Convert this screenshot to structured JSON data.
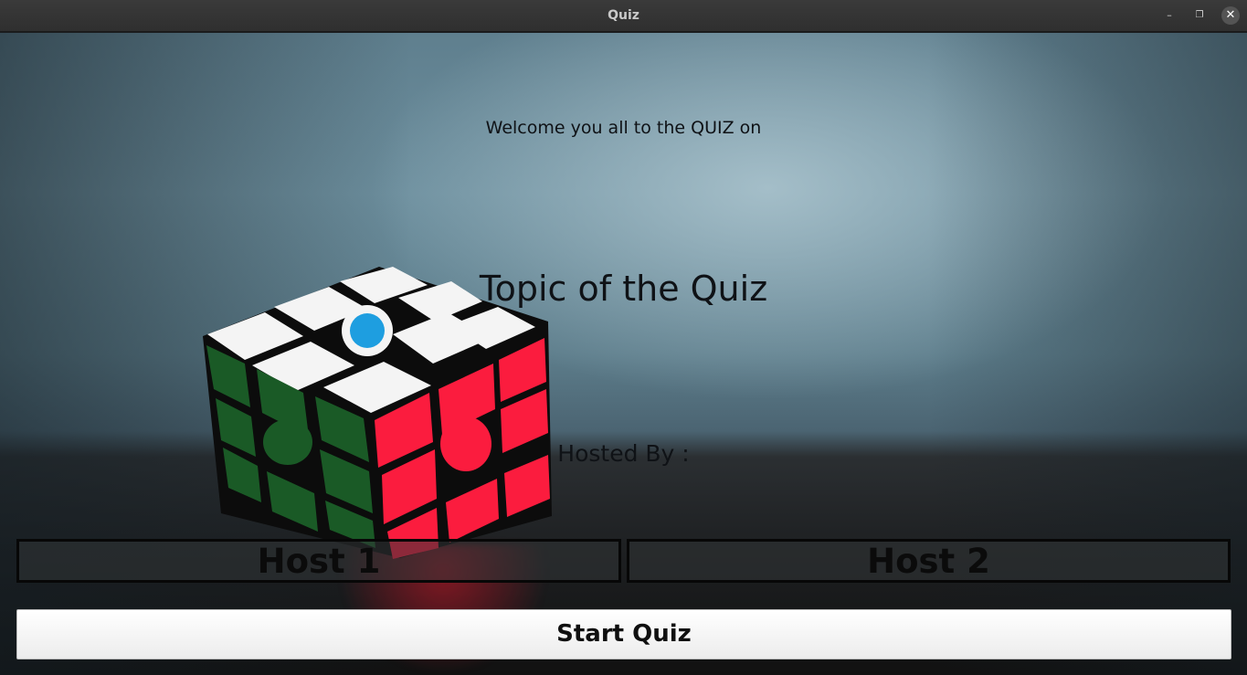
{
  "window": {
    "title": "Quiz",
    "minimize_icon": "–",
    "maximize_icon": "❐",
    "close_icon": "✕"
  },
  "main": {
    "welcome_text": "Welcome you all to the QUIZ on",
    "topic_text": "Topic of the Quiz",
    "hosted_by_text": "Hosted By :",
    "host1": "Host 1",
    "host2": "Host 2",
    "start_button": "Start Quiz"
  },
  "colors": {
    "cube_red": "#fb1c3e",
    "cube_green": "#1a5a26",
    "cube_white": "#f4f4f4",
    "cube_logo": "#1e9ee0"
  }
}
